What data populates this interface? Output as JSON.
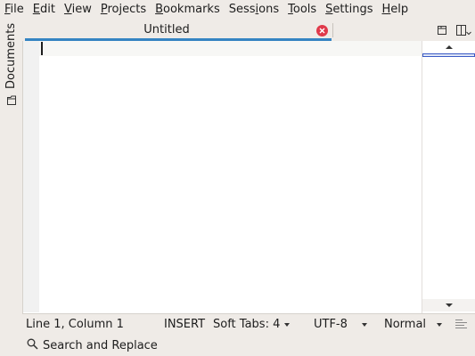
{
  "menu": {
    "file": {
      "acc": "F",
      "rest": "ile"
    },
    "edit": {
      "acc": "E",
      "rest": "dit"
    },
    "view": {
      "acc": "V",
      "rest": "iew"
    },
    "projects": {
      "acc": "P",
      "rest": "rojects"
    },
    "bookmarks": {
      "acc": "B",
      "rest": "ookmarks"
    },
    "sessions": {
      "pre": "Sess",
      "acc": "i",
      "rest": "ons"
    },
    "tools": {
      "acc": "T",
      "rest": "ools"
    },
    "settings": {
      "acc": "S",
      "rest": "ettings"
    },
    "help": {
      "acc": "H",
      "rest": "elp"
    }
  },
  "sidebar": {
    "documents_label": "Documents",
    "documents_icon": "folder-icon"
  },
  "tabs": {
    "active_title": "Untitled",
    "close_icon": "close-icon",
    "underline_color": "#3584c2",
    "close_color": "#e0394a"
  },
  "toolbar": {
    "open_icon": "document-open-icon",
    "split_icon": "split-view-icon"
  },
  "editor": {
    "content": ""
  },
  "statusbar": {
    "position": "Line 1, Column 1",
    "mode": "INSERT",
    "indent": "Soft Tabs: 4",
    "encoding": "UTF-8",
    "highlight_mode": "Normal",
    "dictionary_icon": "paragraph-icon"
  },
  "bottom": {
    "search_label": "Search and Replace",
    "search_icon": "search-icon"
  }
}
